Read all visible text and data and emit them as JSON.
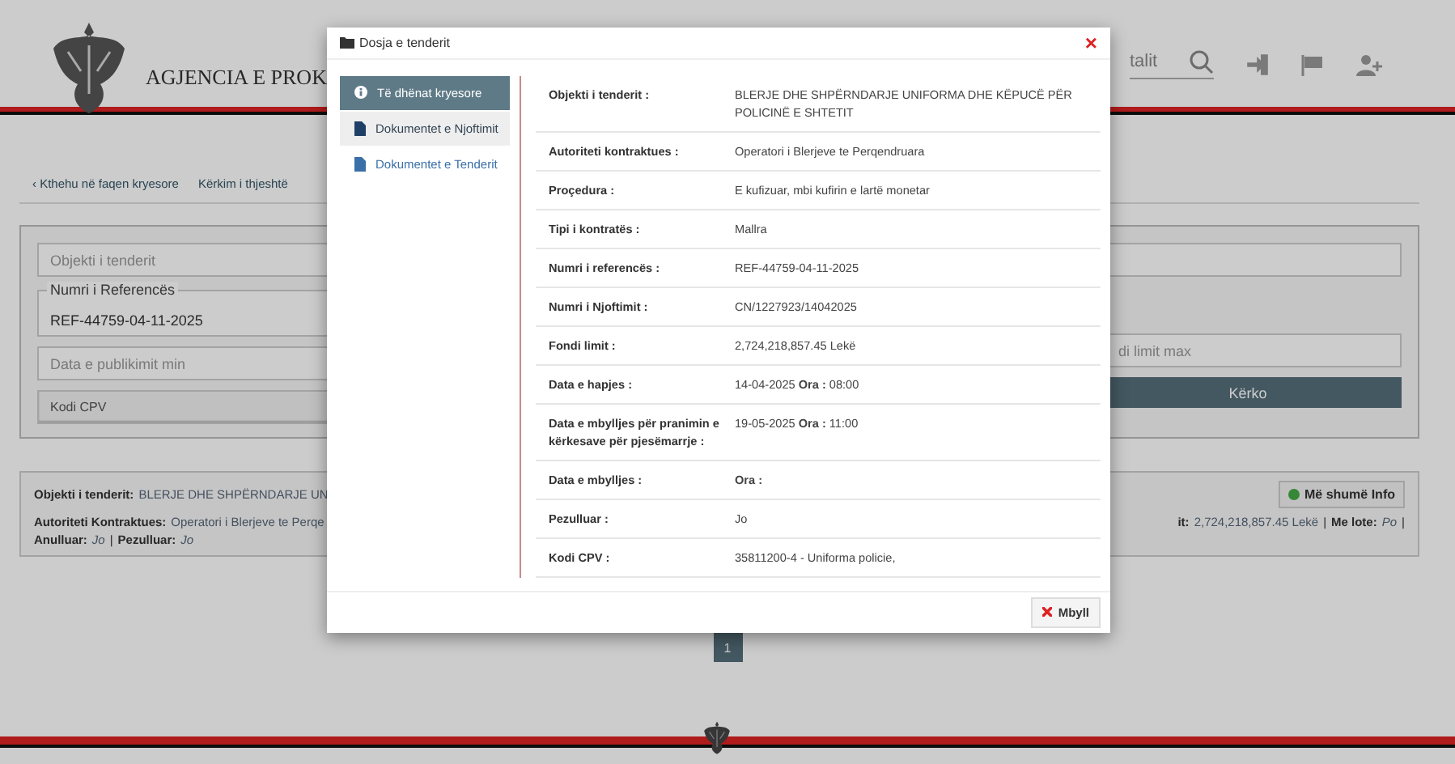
{
  "header": {
    "title": "AGJENCIA E PROK",
    "search_placeholder": "talit"
  },
  "tabs": [
    {
      "label": "‹ Kthehu në faqen kryesore",
      "selected": false
    },
    {
      "label": "Kërkim i thjeshtë",
      "selected": false
    }
  ],
  "search_form": {
    "left_fields": [
      {
        "kind": "input",
        "placeholder": "Objekti i tenderit"
      },
      {
        "kind": "floating",
        "label": "Numri i Referencës",
        "value": "REF-44759-04-11-2025"
      },
      {
        "kind": "input",
        "placeholder": "Data e publikimit min"
      },
      {
        "kind": "select",
        "value": "Kodi CPV"
      }
    ],
    "right_fields": [
      {
        "kind": "input"
      },
      {
        "kind": "none"
      },
      {
        "kind": "input",
        "placeholder": "di limit max"
      },
      {
        "kind": "button",
        "label": "Kërko"
      }
    ]
  },
  "result": {
    "title_label": "Objekti i tenderit:",
    "title_value": "BLERJE DHE SHPËRNDARJE UN",
    "info_button": "Më shumë Info",
    "line_left": [
      {
        "kind": "field",
        "label": "Autoriteti Kontraktues:",
        "value": "Operatori i Blerjeve te Perqe",
        "italic": false
      }
    ],
    "line_right": [
      {
        "kind": "field",
        "label": "it:",
        "value": "2,724,218,857.45 Lekë",
        "italic": false
      },
      {
        "kind": "separator",
        "text": "|"
      },
      {
        "kind": "field",
        "label": "Me lote:",
        "value": "Po",
        "italic": true
      },
      {
        "kind": "separator",
        "text": "|"
      }
    ],
    "line_bottom": [
      {
        "kind": "field",
        "label": "Anulluar:",
        "value": "Jo",
        "italic": true
      },
      {
        "kind": "separator",
        "text": "|"
      },
      {
        "kind": "field",
        "label": "Pezulluar:",
        "value": "Jo",
        "italic": true
      }
    ]
  },
  "pagination": [
    {
      "label": "1",
      "selected": true
    }
  ],
  "modal": {
    "title": "Dosja e tenderit",
    "close_button": "×",
    "nav": [
      {
        "label": "Të dhënat kryesore",
        "kind": "overview",
        "selected": true,
        "hovered": false
      },
      {
        "label": "Dokumentet e Njoftimit",
        "kind": "documents",
        "selected": false,
        "hovered": true
      },
      {
        "label": "Dokumentet e Tenderit",
        "kind": "documents",
        "selected": false,
        "hovered": false
      }
    ],
    "rows": [
      {
        "label": "Objekti i tenderit :",
        "value": "BLERJE DHE SHPËRNDARJE UNIFORMA DHE KËPUCË PËR POLICINË E SHTETIT"
      },
      {
        "label": "Autoriteti kontraktues :",
        "value": "Operatori i Blerjeve te Perqendruara"
      },
      {
        "label": "Proçedura :",
        "value": "E kufizuar, mbi kufirin e lartë monetar"
      },
      {
        "label": "Tipi i kontratës :",
        "value": "Mallra"
      },
      {
        "label": "Numri i referencës :",
        "value": "REF-44759-04-11-2025"
      },
      {
        "label": "Numri i Njoftimit :",
        "value": "CN/1227923/14042025"
      },
      {
        "label": "Fondi limit :",
        "value": "2,724,218,857.45 Lekë"
      },
      {
        "label": "Data e hapjes :",
        "value": "14-04-2025 **Ora :** 08:00"
      },
      {
        "label": "Data e mbylljes për pranimin e kërkesave për pjesëmarrje :",
        "value": "19-05-2025 **Ora :** 11:00"
      },
      {
        "label": "Data e mbylljes :",
        "value": "Ora :",
        "value_bold": true
      },
      {
        "label": "Pezulluar :",
        "value": "Jo"
      },
      {
        "label": "Kodi CPV :",
        "value": "35811200-4 - Uniforma policie,"
      }
    ],
    "close_label": "Mbyll"
  }
}
